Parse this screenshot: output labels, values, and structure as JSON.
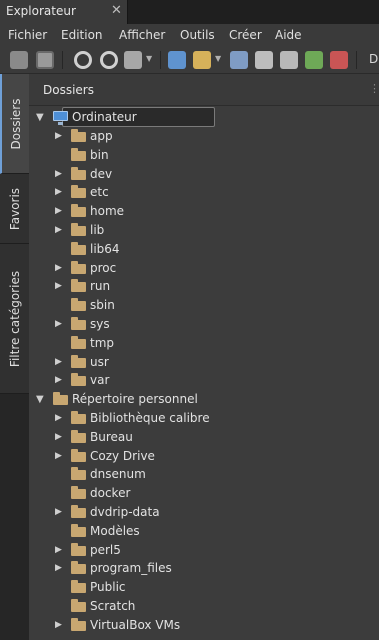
{
  "window": {
    "tab_title": "Explorateur",
    "close_symbol": "✕"
  },
  "menu": [
    "Fichier",
    "Edition",
    "Afficher",
    "Outils",
    "Créer",
    "Aide"
  ],
  "toolbar": {
    "overflow_text": "D"
  },
  "side_tabs": [
    "Dossiers",
    "Favoris",
    "Filtre catégories"
  ],
  "panel": {
    "title": "Dossiers",
    "grip": "⋮⋮"
  },
  "tree": {
    "root1": "Ordinateur",
    "root1_children": [
      "app",
      "bin",
      "dev",
      "etc",
      "home",
      "lib",
      "lib64",
      "proc",
      "run",
      "sbin",
      "sys",
      "tmp",
      "usr",
      "var"
    ],
    "root2": "Répertoire personnel",
    "root2_children": [
      "Bibliothèque calibre",
      "Bureau",
      "Cozy Drive",
      "dnsenum",
      "docker",
      "dvdrip-data",
      "Modèles",
      "perl5",
      "program_files",
      "Public",
      "Scratch",
      "VirtualBox VMs"
    ]
  },
  "colors": {
    "accent": "#6fa0d8",
    "folder": "#c8a771",
    "background": "#3c3c3c"
  }
}
